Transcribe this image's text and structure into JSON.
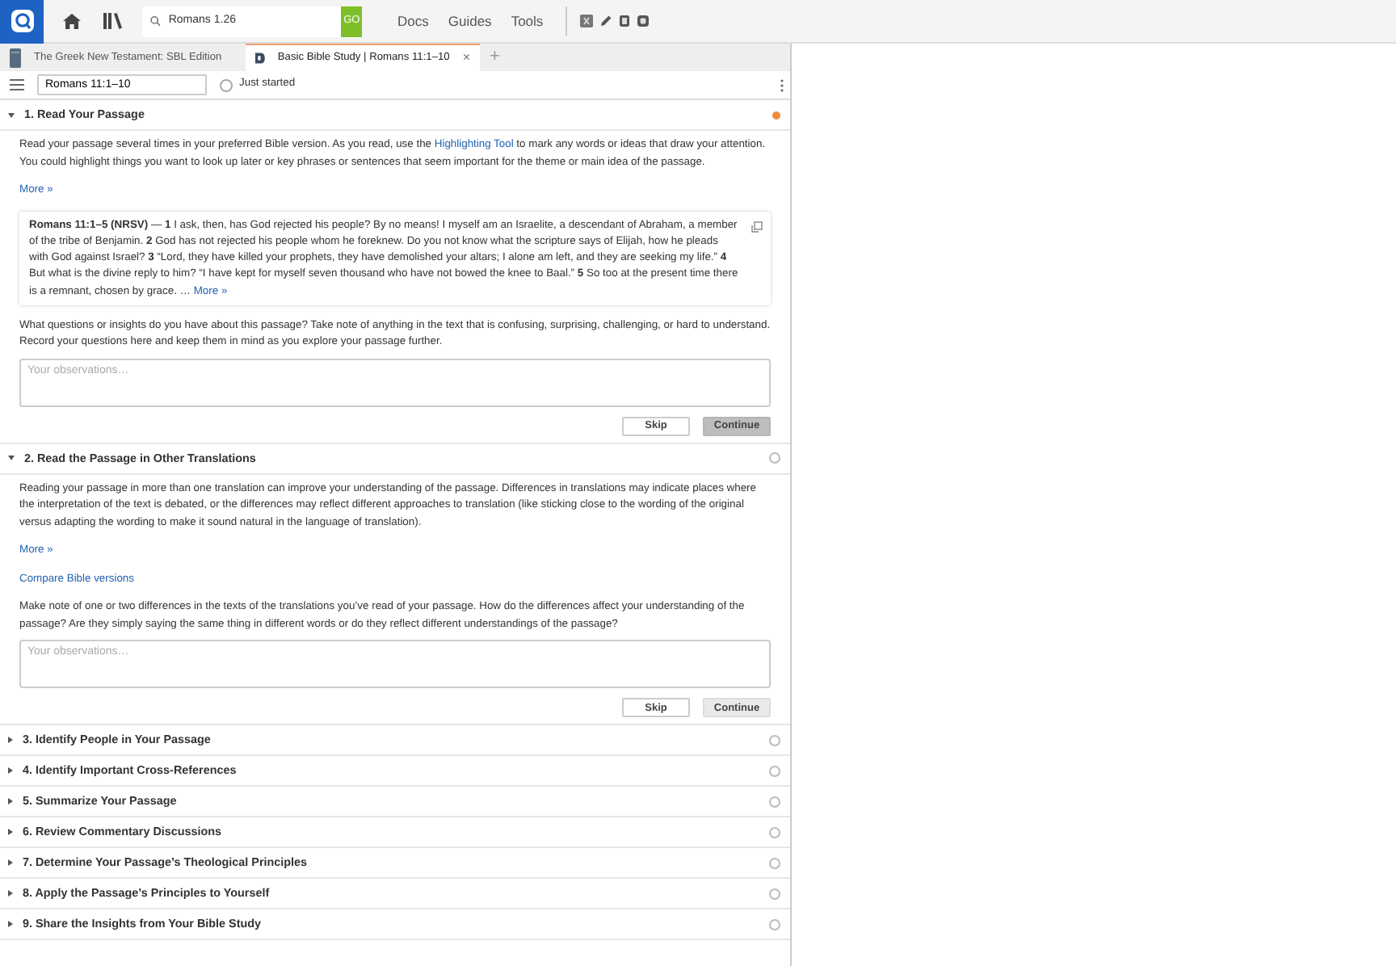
{
  "app_bar": {
    "search": {
      "value": "Romans 1.26",
      "button": "GO"
    },
    "menu": [
      "Docs",
      "Guides",
      "Tools"
    ]
  },
  "tabs": [
    {
      "title": "The Greek New Testament: SBL Edition",
      "kind": "book",
      "selected": false
    },
    {
      "title": "Basic Bible Study | Romans 11:1–10",
      "kind": "doc",
      "selected": true,
      "close": "×"
    }
  ],
  "new_tab": "+",
  "doc_toolbar": {
    "passage": "Romans 11:1–10",
    "status": "Just started",
    "checked": false
  },
  "steps": [
    {
      "title": "1. Read Your Passage",
      "expanded": true,
      "in_progress": true,
      "intro": [
        {
          "kind": "text",
          "text": "Read your passage several times in your preferred Bible version. As you read, use the "
        },
        {
          "kind": "link",
          "text": "Highlighting Tool"
        },
        {
          "kind": "text",
          "text": " to mark any words or ideas that draw your attention. You could highlight things you want to look up later or key phrases or sentences that seem important for the theme or main idea of the passage."
        }
      ],
      "more": "More »",
      "passage": {
        "text": "**Romans 11:1–5 (NRSV)** — **1** I ask, then, has God rejected his people? By no means! I myself am an Israelite, a descendant of Abraham, a member of the tribe of Benjamin. **2** God has not rejected his people whom he foreknew. Do you not know what the scripture says of Elijah, how he pleads with God against Israel? **3** “Lord, they have killed your prophets, they have demolished your altars; I alone am left, and they are seeking my life.” **4** But what is the divine reply to him? “I have kept for myself seven thousand who have not bowed the knee to Baal.” **5** So too at the present time there is a remnant, chosen by grace. …",
        "more": "More »"
      },
      "prompt": "What questions or insights do you have about this passage? Take note of anything in the text that is confusing, surprising, challenging, or hard to understand. Record your questions here and keep them in mind as you explore your passage further.",
      "placeholder": "Your observations…",
      "skip": "Skip",
      "continue": "Continue",
      "continue_highlighted": true
    },
    {
      "title": "2. Read the Passage in Other Translations",
      "expanded": true,
      "in_progress": false,
      "intro": [
        {
          "kind": "text",
          "text": "Reading your passage in more than one translation can improve your understanding of the passage. Differences in translations may indicate places where the interpretation of the text is debated, or the differences may reflect different approaches to translation (like sticking close to the wording of the original versus adapting the wording to make it sound natural in the language of translation)."
        }
      ],
      "more": "More »",
      "action_link": "Compare Bible versions",
      "prompt": "Make note of one or two differences in the texts of the translations you’ve read of your passage. How do the differences affect your understanding of the passage? Are they simply saying the same thing in different words or do they reflect different understandings of the passage?",
      "placeholder": "Your observations…",
      "skip": "Skip",
      "continue": "Continue",
      "continue_highlighted": false
    },
    {
      "title": "3. Identify People in Your Passage",
      "expanded": false,
      "in_progress": false
    },
    {
      "title": "4. Identify Important Cross-References",
      "expanded": false,
      "in_progress": false
    },
    {
      "title": "5. Summarize Your Passage",
      "expanded": false,
      "in_progress": false
    },
    {
      "title": "6. Review Commentary Discussions",
      "expanded": false,
      "in_progress": false
    },
    {
      "title": "7. Determine Your Passage’s Theological Principles",
      "expanded": false,
      "in_progress": false
    },
    {
      "title": "8. Apply the Passage’s Principles to Yourself",
      "expanded": false,
      "in_progress": false
    },
    {
      "title": "9. Share the Insights from Your Bible Study",
      "expanded": false,
      "in_progress": false
    }
  ]
}
